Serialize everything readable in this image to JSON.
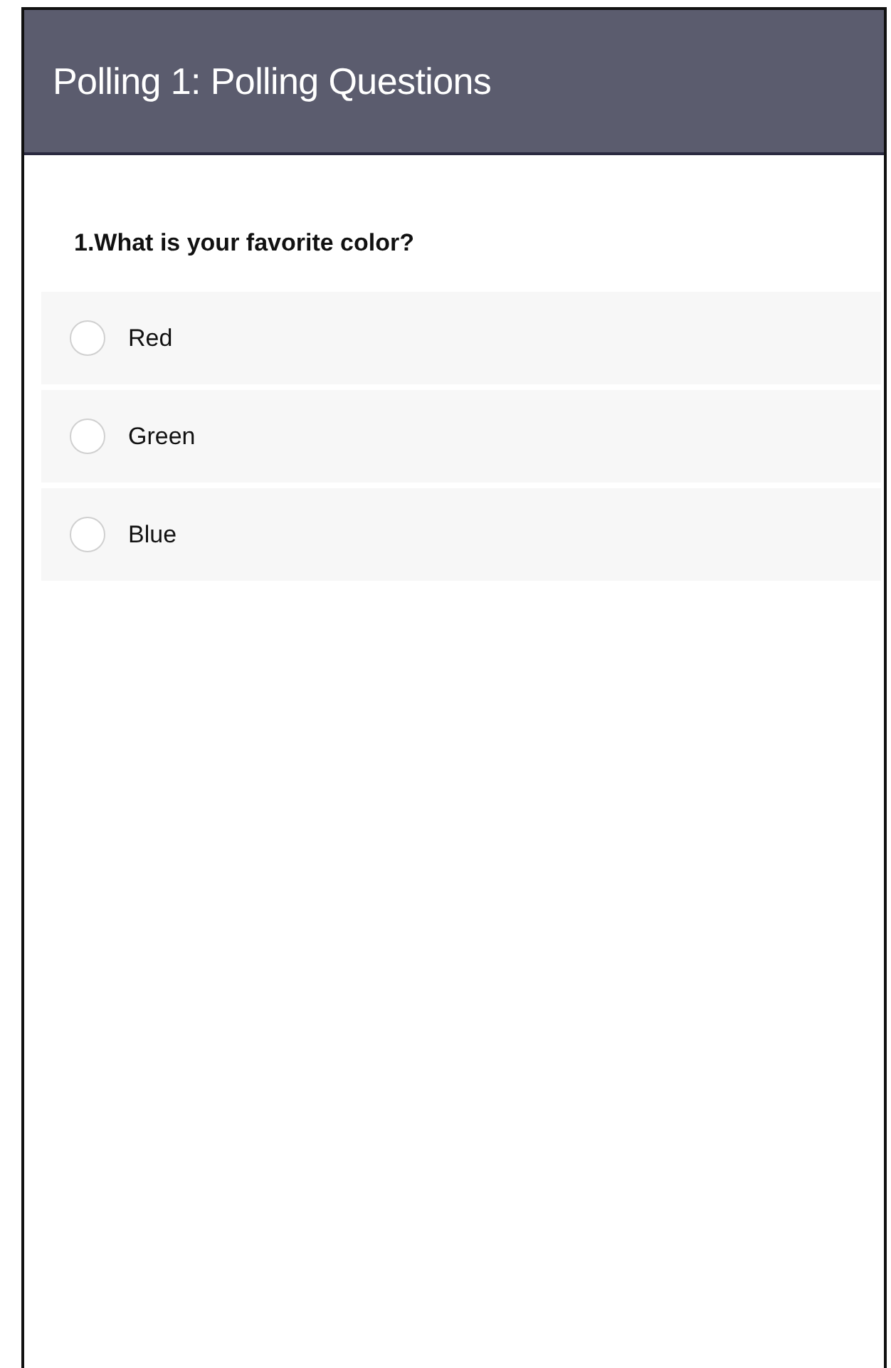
{
  "header": {
    "title": "Polling 1: Polling Questions"
  },
  "question": {
    "text": "1.What is your favorite color?",
    "options": [
      {
        "label": "Red",
        "selected": false
      },
      {
        "label": "Green",
        "selected": false
      },
      {
        "label": "Blue",
        "selected": false
      }
    ]
  }
}
